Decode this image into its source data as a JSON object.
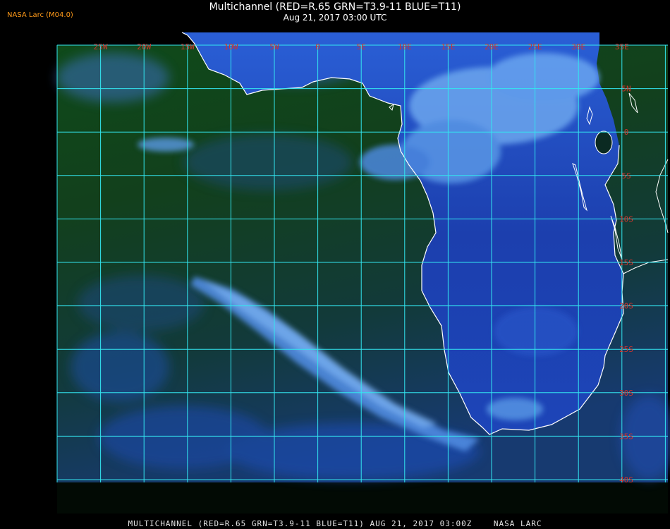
{
  "header": {
    "title": "Multichannel (RED=R.65 GRN=T3.9-11 BLUE=T11)",
    "datetime": "Aug 21, 2017 03:00 UTC",
    "brand": "NASA Larc (M04.0)"
  },
  "footer": {
    "caption": "MULTICHANNEL (RED=R.65 GRN=T3.9-11 BLUE=T11) AUG 21, 2017 03:00Z    NASA LARC"
  },
  "map": {
    "longitude_labels": [
      "25W",
      "20W",
      "15W",
      "10W",
      "5W",
      "0",
      "5E",
      "10E",
      "15E",
      "20E",
      "25E",
      "30E",
      "35E"
    ],
    "latitude_labels": [
      "5N",
      "0",
      "5S",
      "10S",
      "15S",
      "20S",
      "25S",
      "30S",
      "35S",
      "40S"
    ],
    "colors": {
      "background": "#000000",
      "ocean": "#0e3a14",
      "land": "#1a3fb0",
      "cloud": "#5b9be8",
      "grid": "#33e6f0",
      "label": "#d0342c",
      "coastline": "#ffffff"
    }
  }
}
